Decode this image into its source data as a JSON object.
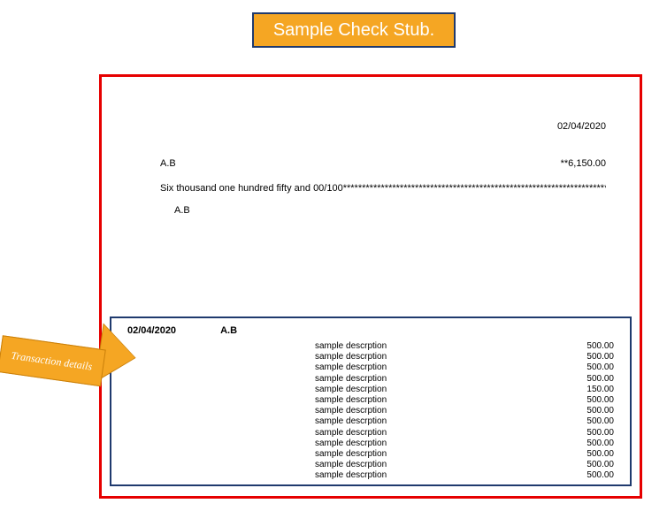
{
  "header": {
    "label": "Sample Check Stub."
  },
  "check": {
    "date": "02/04/2020",
    "payee": "A.B",
    "amount_numeric": "**6,150.00",
    "amount_words": "Six thousand one hundred fifty and 00/100***************************************************************************",
    "payee_repeat": "A.B"
  },
  "stub": {
    "date": "02/04/2020",
    "payee": "A.B",
    "rows": [
      {
        "desc": "sample descrption",
        "amount": "500.00"
      },
      {
        "desc": "sample descrption",
        "amount": "500.00"
      },
      {
        "desc": "sample descrption",
        "amount": "500.00"
      },
      {
        "desc": "sample descrption",
        "amount": "500.00"
      },
      {
        "desc": "sample descrption",
        "amount": "150.00"
      },
      {
        "desc": "sample descrption",
        "amount": "500.00"
      },
      {
        "desc": "sample descrption",
        "amount": "500.00"
      },
      {
        "desc": "sample descrption",
        "amount": "500.00"
      },
      {
        "desc": "sample descrption",
        "amount": "500.00"
      },
      {
        "desc": "sample descrption",
        "amount": "500.00"
      },
      {
        "desc": "sample descrption",
        "amount": "500.00"
      },
      {
        "desc": "sample descrption",
        "amount": "500.00"
      },
      {
        "desc": "sample descrption",
        "amount": "500.00"
      }
    ]
  },
  "callout": {
    "label": "Transaction details"
  }
}
